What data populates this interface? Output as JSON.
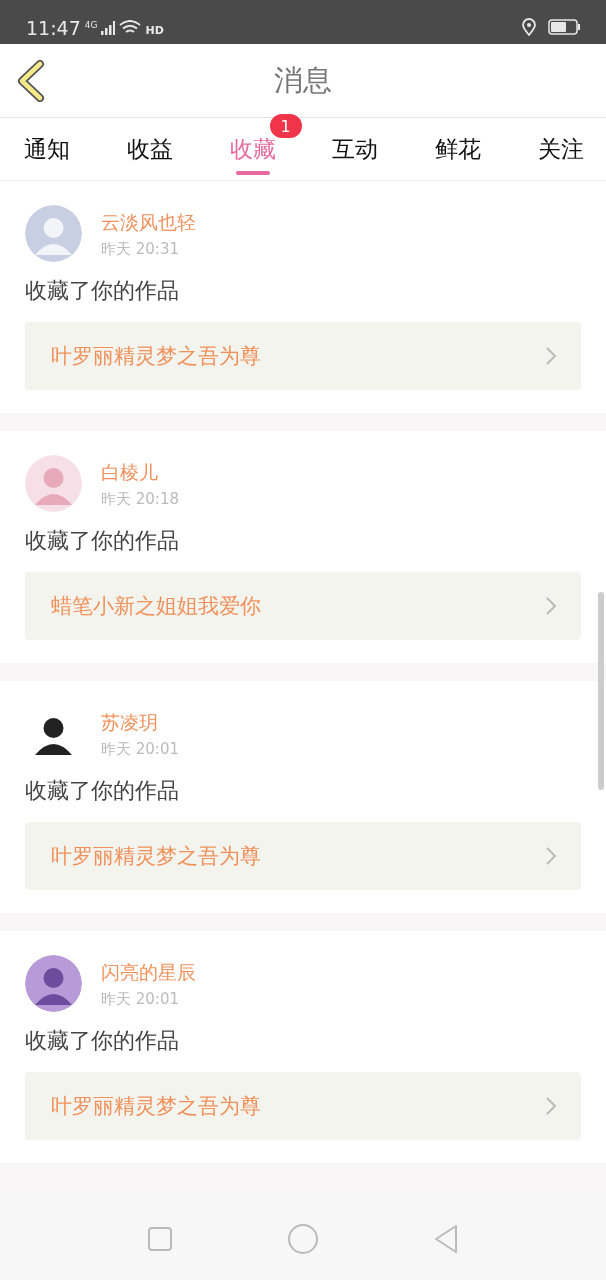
{
  "status_bar": {
    "time": "11:47",
    "network": "4G",
    "hd": "HD"
  },
  "header": {
    "title": "消息"
  },
  "tabs": [
    {
      "label": "通知",
      "selected": false
    },
    {
      "label": "收益",
      "selected": false
    },
    {
      "label": "收藏",
      "selected": true,
      "badge": "1"
    },
    {
      "label": "互动",
      "selected": false
    },
    {
      "label": "鲜花",
      "selected": false
    },
    {
      "label": "关注",
      "selected": false
    }
  ],
  "messages": [
    {
      "name": "云淡风也轻",
      "time": "昨天 20:31",
      "text": "收藏了你的作品",
      "work": "叶罗丽精灵梦之吾为尊"
    },
    {
      "name": "白棱儿",
      "time": "昨天 20:18",
      "text": "收藏了你的作品",
      "work": "蜡笔小新之姐姐我爱你"
    },
    {
      "name": "苏凌玥",
      "time": "昨天 20:01",
      "text": "收藏了你的作品",
      "work": "叶罗丽精灵梦之吾为尊"
    },
    {
      "name": "闪亮的星辰",
      "time": "昨天 20:01",
      "text": "收藏了你的作品",
      "work": "叶罗丽精灵梦之吾为尊"
    }
  ]
}
